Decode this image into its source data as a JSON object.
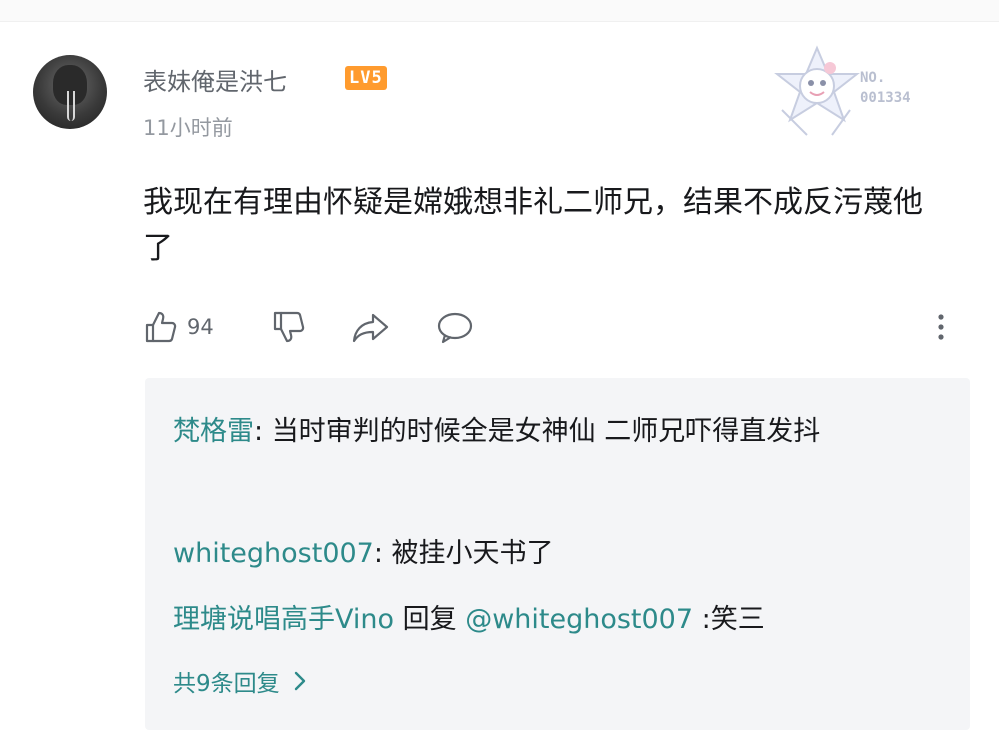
{
  "comment": {
    "username": "表妹俺是洪七",
    "level_badge": "LV5",
    "timestamp": "11小时前",
    "text": "我现在有理由怀疑是嫦娥想非礼二师兄，结果不成反污蔑他了",
    "stamp_line1": "NO.",
    "stamp_line2": "001334",
    "actions": {
      "like_icon": "thumbs-up-icon",
      "like_count": "94",
      "dislike_icon": "thumbs-down-icon",
      "share_icon": "share-icon",
      "reply_icon": "comment-bubble-icon",
      "more_icon": "more-vertical-icon"
    }
  },
  "replies": [
    {
      "author": "梵格雷",
      "separator": ": ",
      "text": "当时审判的时候全是女神仙 二师兄吓得直发抖"
    },
    {
      "author": "whiteghost007",
      "separator": ": ",
      "text": "被挂小天书了"
    },
    {
      "author": "理塘说唱高手Vino",
      "middle": " 回复 ",
      "mention": "@whiteghost007",
      "text": " :笑三"
    }
  ],
  "reply_count_label": "共9条回复",
  "colors": {
    "link": "#2d8a8a",
    "badge": "#ff9b2e",
    "reply_bg": "#f4f5f7",
    "meta": "#9499a0"
  }
}
